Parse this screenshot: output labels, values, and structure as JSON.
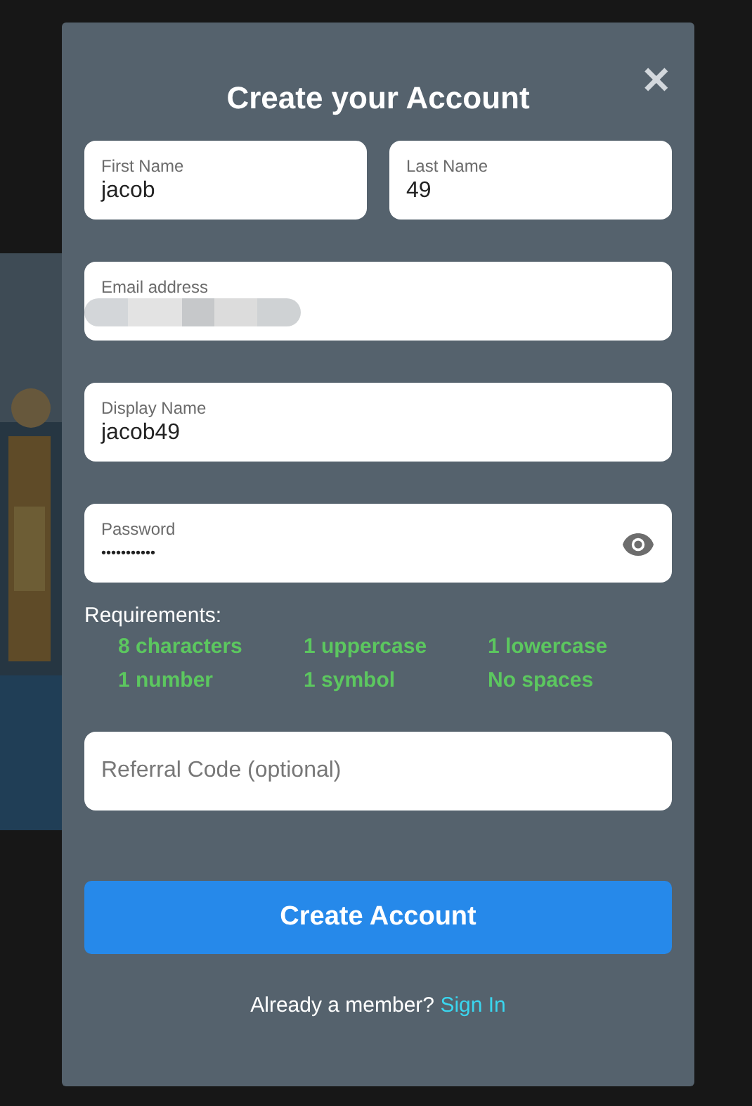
{
  "dialog": {
    "title": "Create your Account",
    "close": "✕"
  },
  "fields": [
    {
      "label": "First Name",
      "value": "jacob"
    },
    {
      "label": "Last Name",
      "value": "49"
    },
    {
      "label": "Email address",
      "value_redacted": true
    },
    {
      "label": "Display Name",
      "value": "jacob49"
    },
    {
      "label": "Password",
      "value": "•••••••••••",
      "reveal_toggle": true
    }
  ],
  "requirements": {
    "title": "Requirements:",
    "items": [
      {
        "text": "8 characters",
        "met": true
      },
      {
        "text": "1 uppercase",
        "met": true
      },
      {
        "text": "1 lowercase",
        "met": true
      },
      {
        "text": "1 number",
        "met": true
      },
      {
        "text": "1 symbol",
        "met": true
      },
      {
        "text": "No spaces",
        "met": true
      }
    ]
  },
  "referral": {
    "placeholder": "Referral Code (optional)"
  },
  "submit": "Create Account",
  "footer": {
    "text": "Already a member?",
    "link": "Sign In"
  }
}
